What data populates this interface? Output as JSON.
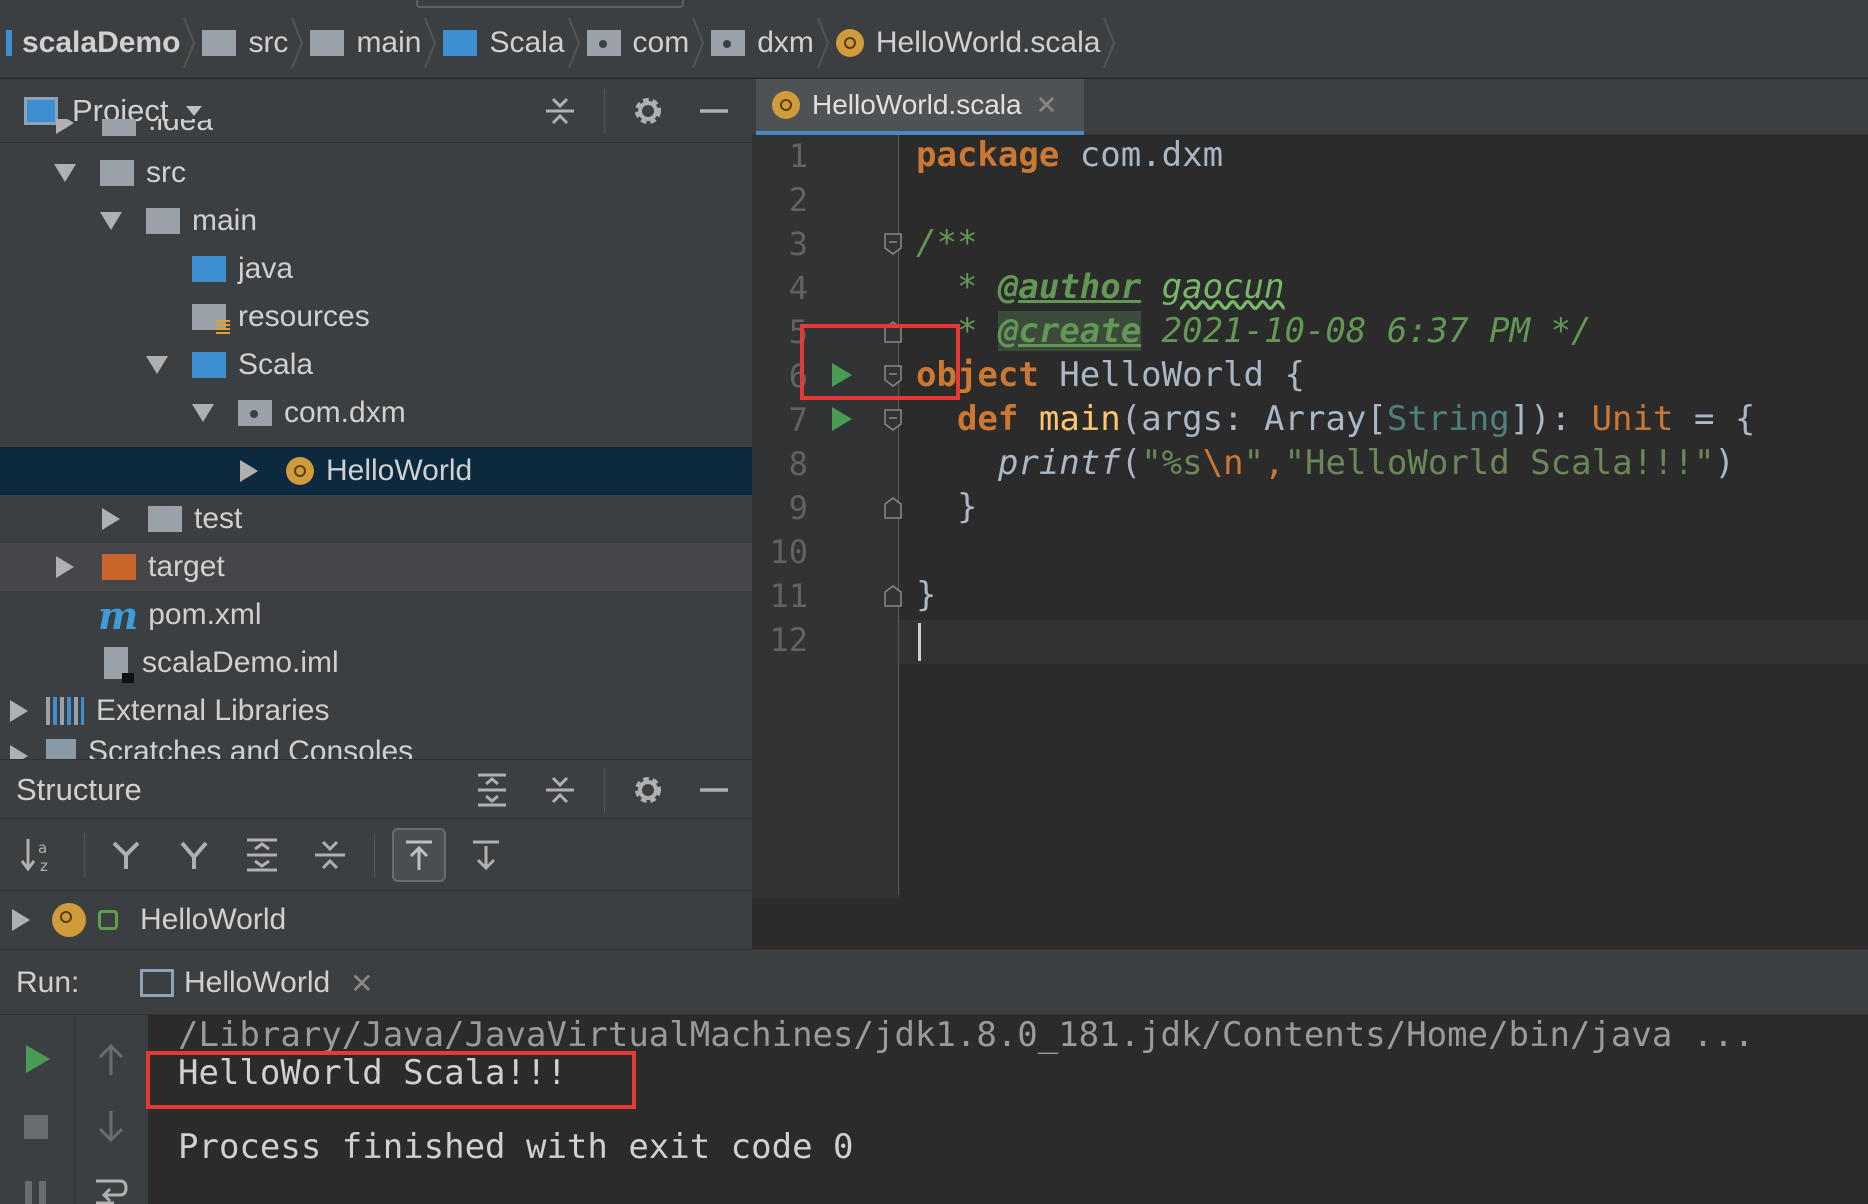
{
  "breadcrumb": {
    "items": [
      {
        "label": "scalaDemo",
        "icon": "project-module-icon"
      },
      {
        "label": "src",
        "icon": "folder-icon"
      },
      {
        "label": "main",
        "icon": "folder-icon"
      },
      {
        "label": "Scala",
        "icon": "source-folder-icon"
      },
      {
        "label": "com",
        "icon": "package-icon"
      },
      {
        "label": "dxm",
        "icon": "package-icon"
      },
      {
        "label": "HelloWorld.scala",
        "icon": "scala-object-icon"
      }
    ]
  },
  "project_panel": {
    "title": "Project",
    "tree": [
      {
        "label": ".idea",
        "depth": 1,
        "expanded": false,
        "icon": "folder-icon"
      },
      {
        "label": "src",
        "depth": 1,
        "expanded": true,
        "icon": "folder-icon"
      },
      {
        "label": "main",
        "depth": 2,
        "expanded": true,
        "icon": "folder-icon"
      },
      {
        "label": "java",
        "depth": 3,
        "icon": "source-folder-icon"
      },
      {
        "label": "resources",
        "depth": 3,
        "icon": "resources-folder-icon"
      },
      {
        "label": "Scala",
        "depth": 3,
        "expanded": true,
        "icon": "source-folder-icon"
      },
      {
        "label": "com.dxm",
        "depth": 4,
        "expanded": true,
        "icon": "package-icon"
      },
      {
        "label": "HelloWorld",
        "depth": 5,
        "expanded": false,
        "icon": "scala-object-icon",
        "selected": true
      },
      {
        "label": "test",
        "depth": 2,
        "expanded": false,
        "icon": "folder-icon"
      },
      {
        "label": "target",
        "depth": 1,
        "expanded": false,
        "icon": "excluded-folder-icon"
      },
      {
        "label": "pom.xml",
        "depth": 1,
        "icon": "maven-icon"
      },
      {
        "label": "scalaDemo.iml",
        "depth": 1,
        "icon": "iml-file-icon"
      },
      {
        "label": "External Libraries",
        "depth": 0,
        "expanded": false,
        "icon": "libraries-icon"
      },
      {
        "label": "Scratches and Consoles",
        "depth": 0,
        "expanded": false,
        "icon": "scratches-icon"
      }
    ]
  },
  "structure_panel": {
    "title": "Structure",
    "item": "HelloWorld"
  },
  "editor": {
    "tab_label": "HelloWorld.scala",
    "line_numbers": [
      "1",
      "2",
      "3",
      "4",
      "5",
      "6",
      "7",
      "8",
      "9",
      "10",
      "11",
      "12"
    ],
    "code": {
      "l1_kw": "package",
      "l1_rest": " com.dxm",
      "l3": "/**",
      "l4_star": "  * ",
      "l4_tag": "@author",
      "l4_val": "gaocun",
      "l5_star": "  * ",
      "l5_tag": "@create",
      "l5_rest": " 2021-10-08 6:37 PM */",
      "l6_kw": "object",
      "l6_rest": " HelloWorld {",
      "l7_kw": "def",
      "l7_fn": "main",
      "l7_a": "(args: Array[",
      "l7_type": "String",
      "l7_b": "]): ",
      "l7_unit": "Unit",
      "l7_c": " = {",
      "l8_fn": "printf",
      "l8_a": "(",
      "l8_str1": "\"%s",
      "l8_esc": "\\n",
      "l8_str2": "\"",
      "l8_comma": ",",
      "l8_str3": "\"HelloWorld Scala!!!\"",
      "l8_b": ")",
      "l9": "}",
      "l11": "}"
    }
  },
  "run_panel": {
    "label": "Run:",
    "tab_label": "HelloWorld",
    "output": {
      "command": "/Library/Java/JavaVirtualMachines/jdk1.8.0_181.jdk/Contents/Home/bin/java ...",
      "result": "HelloWorld Scala!!!",
      "blank": "",
      "exit": "Process finished with exit code 0"
    }
  },
  "colors": {
    "highlight_box": "#e53935",
    "keyword": "#cc7832",
    "doc_comment": "#629755",
    "string": "#6a8759",
    "selection": "#0d293e"
  }
}
